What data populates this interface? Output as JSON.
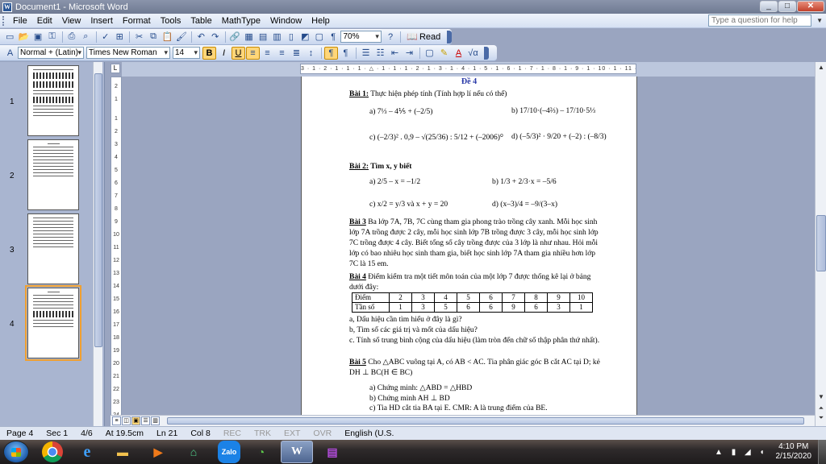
{
  "window": {
    "title": "Document1 - Microsoft Word",
    "minimize": "_",
    "maximize": "□",
    "close": "✕"
  },
  "menu": {
    "items": [
      "File",
      "Edit",
      "View",
      "Insert",
      "Format",
      "Tools",
      "Table",
      "MathType",
      "Window",
      "Help"
    ],
    "help_placeholder": "Type a question for help"
  },
  "toolbar": {
    "zoom": "70%",
    "read_label": "Read",
    "style": "Normal + (Latin)",
    "font": "Times New Roman",
    "font_size": "14"
  },
  "thumbnails": [
    "1",
    "2",
    "3",
    "4"
  ],
  "document": {
    "title": "Đề 4",
    "bai1_label": "Bài 1:",
    "bai1_text": " Thực hiện phép tính (Tính hợp lí nếu có thể)",
    "bai1_a": "a) 7⅓ – 4⅕ + (–2/5)",
    "bai1_b": "b) 17/10·(–4⅔) – 17/10·5⅓",
    "bai1_c": "c) (–2/3)² . 0,9 – √(25/36) : 5/12 + (–2006)⁰",
    "bai1_d": "d) (–5/3)² · 9/20 + (–2) : (–8/3)",
    "bai2_label": "Bài 2:",
    "bai2_text": " Tìm x, y biết",
    "bai2_a": "a) 2/5 – x = –1/2",
    "bai2_b": "b) 1/3 + 2/3·x = –5/6",
    "bai2_c": "c) x/2 = y/3  và x + y = 20",
    "bai2_d": "d) (x–3)/4 = –9/(3–x)",
    "bai3_label": "Bài 3",
    "bai3_text": " Ba lớp 7A, 7B, 7C cùng tham gia phong trào trồng cây xanh. Mỗi học sinh lớp 7A trồng được 2 cây, mỗi học sinh lớp 7B trồng được 3 cây, mỗi học sinh lớp 7C trồng được 4 cây. Biết tổng số cây trồng được của 3 lớp là như nhau. Hỏi mỗi lớp có bao nhiêu học sinh tham gia, biết học sinh lớp 7A tham gia nhiều hơn lớp 7C là 15 em.",
    "bai4_label": "Bài 4",
    "bai4_text": " Điểm kiểm tra một tiết môn toán của một lớp 7 được thống kê lại ở bảng dưới đây:",
    "table_row1": [
      "Điểm",
      "2",
      "3",
      "4",
      "5",
      "6",
      "7",
      "8",
      "9",
      "10"
    ],
    "table_row2": [
      "Tần số",
      "1",
      "3",
      "5",
      "6",
      "6",
      "9",
      "6",
      "3",
      "1"
    ],
    "bai4_a": "a, Dấu hiệu cần tìm hiểu ở đây là gì?",
    "bai4_b": "b, Tìm số các giá trị và mốt của dấu hiệu?",
    "bai4_c": "c. Tính số trung bình cộng của dấu hiệu (làm tròn đến chữ số thập phân thứ nhất).",
    "bai5_label": "Bài 5",
    "bai5_text": " Cho △ABC vuông tại A, có AB < AC. Tia phân giác góc B cắt AC tại D; kẻ DH ⊥ BC(H ∈ BC)",
    "bai5_a": "a) Chứng minh: △ABD = △HBD",
    "bai5_b": "b) Chứng minh AH ⊥ BD",
    "bai5_c": "c) Tia HD cắt tia BA tại E. CMR: A là trung điểm của BE."
  },
  "ruler": "3 · 1 · 2 · 1 · 1 · 1 · △ · 1 · 1 · 1 · 2 · 1 · 3 · 1 · 4 · 1 · 5 · 1 · 6 · 1 · 7 · 1 · 8 · 1 · 9 · 1 · 10 · 1 · 11 · 1 · 12 · 1 · 13 · 1 · 14 · 1 · 15 · 1 · △ · 17 ·",
  "vruler": [
    "2",
    "1",
    "1",
    "2",
    "3",
    "4",
    "5",
    "6",
    "7",
    "8",
    "9",
    "10",
    "11",
    "12",
    "13",
    "14",
    "15",
    "16",
    "17",
    "18",
    "19",
    "20",
    "21",
    "22",
    "23",
    "24",
    "25"
  ],
  "status": {
    "page": "Page 4",
    "sec": "Sec 1",
    "count": "4/6",
    "at": "At 19.5cm",
    "ln": "Ln 21",
    "col": "Col 8",
    "rec": "REC",
    "trk": "TRK",
    "ext": "EXT",
    "ovr": "OVR",
    "lang": "English (U.S."
  },
  "taskbar": {
    "time": "4:10 PM",
    "date": "2/15/2020",
    "apps": [
      "chrome",
      "ie",
      "explorer",
      "media",
      "android",
      "zalo",
      "cc",
      "word",
      "winrar"
    ]
  }
}
